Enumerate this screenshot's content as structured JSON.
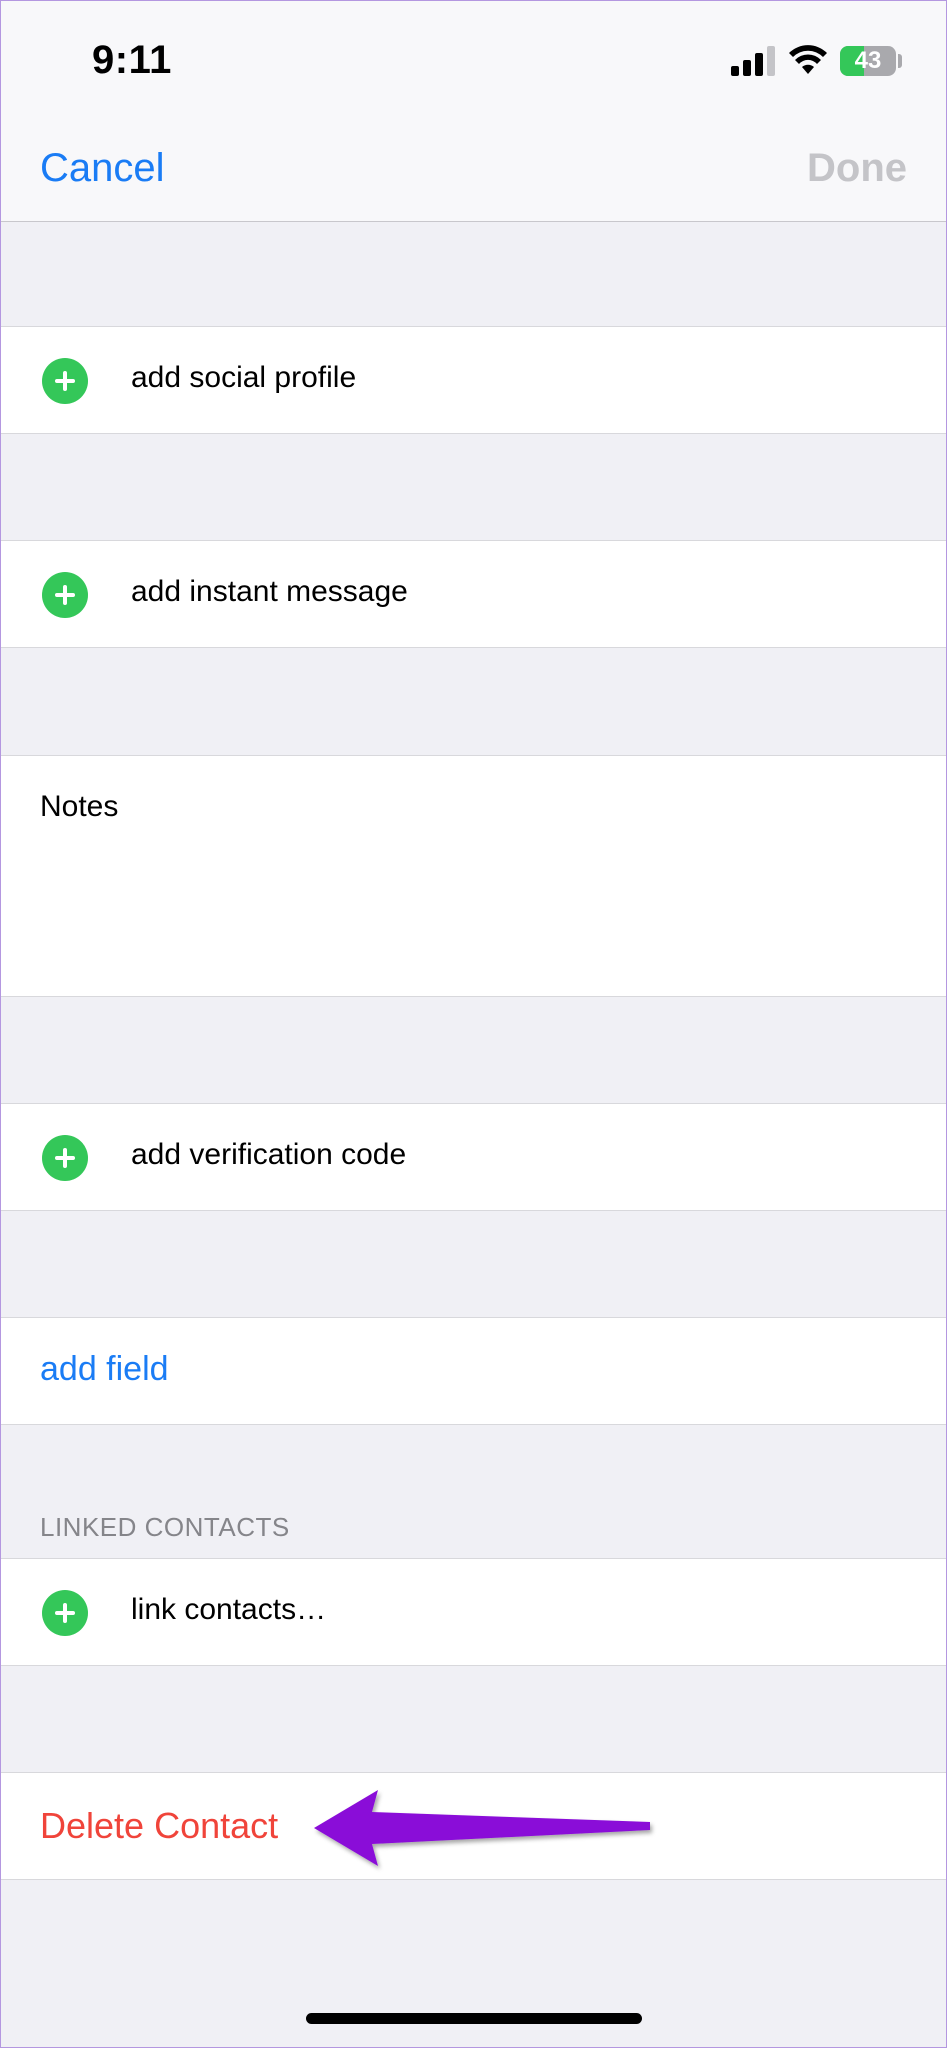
{
  "status_bar": {
    "time": "9:11",
    "battery_level": "43",
    "battery_percent": 43
  },
  "nav": {
    "cancel_label": "Cancel",
    "done_label": "Done"
  },
  "rows": {
    "social_profile": "add social profile",
    "instant_message": "add instant message",
    "notes_label": "Notes",
    "verification_code": "add verification code",
    "add_field": "add field",
    "linked_contacts_header": "LINKED CONTACTS",
    "link_contacts": "link contacts…",
    "delete_contact": "Delete Contact"
  },
  "colors": {
    "accent_blue": "#1a7cf5",
    "destructive_red": "#f0443a",
    "add_green": "#34c759",
    "annotation_arrow": "#8a10d8",
    "disabled_gray": "#c4c4c8"
  },
  "icons": [
    "signal-icon",
    "wifi-icon",
    "battery-icon",
    "plus-circle-icon",
    "annotation-arrow"
  ]
}
